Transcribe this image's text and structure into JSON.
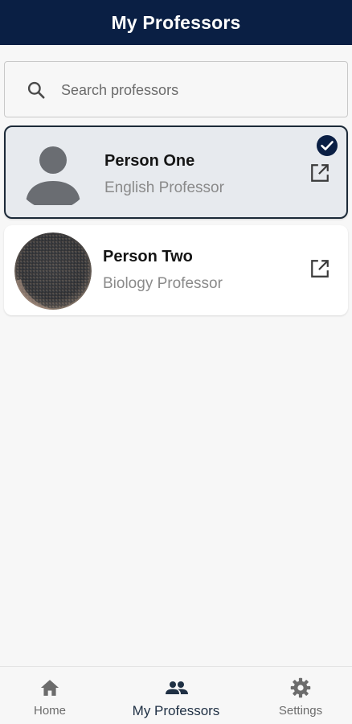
{
  "header": {
    "title": "My Professors"
  },
  "search": {
    "placeholder": "Search professors",
    "value": ""
  },
  "professors": [
    {
      "name": "Person One",
      "role": "English Professor",
      "selected": true,
      "avatar": "default-person-icon"
    },
    {
      "name": "Person Two",
      "role": "Biology Professor",
      "selected": false,
      "avatar": "photo"
    }
  ],
  "bottom_nav": {
    "items": [
      {
        "label": "Home",
        "icon": "home-icon",
        "active": false
      },
      {
        "label": "My Professors",
        "icon": "people-icon",
        "active": true
      },
      {
        "label": "Settings",
        "icon": "gear-icon",
        "active": false
      }
    ]
  },
  "colors": {
    "app_bar": "#0a1f44",
    "selected_card_bg": "#e7eaee",
    "selected_border": "#1c2a38",
    "active_nav": "#1f3044",
    "inactive_nav": "#6c6c6c"
  }
}
